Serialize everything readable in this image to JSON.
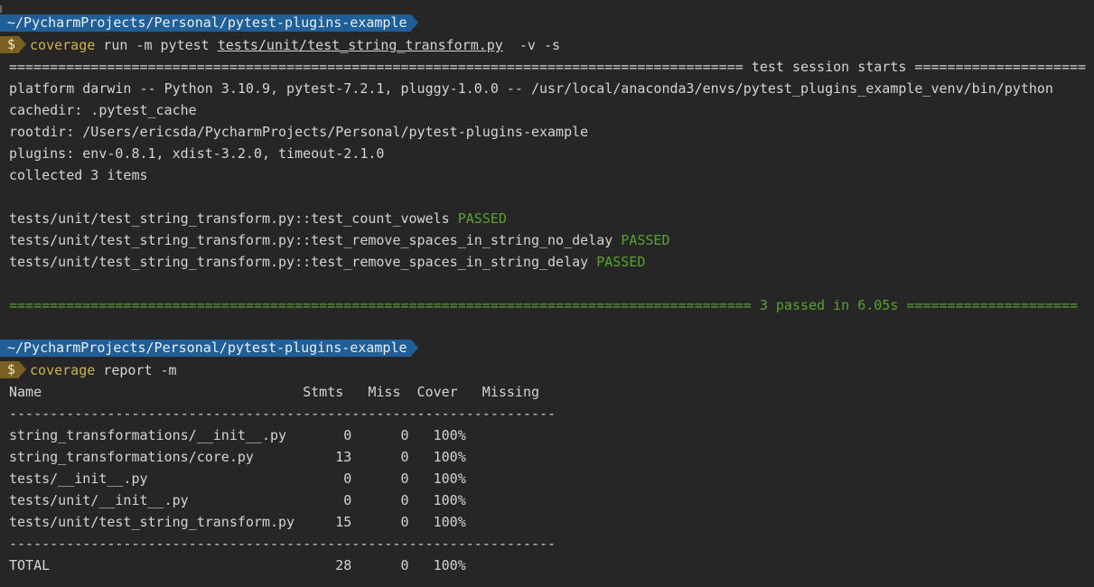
{
  "prompt1": {
    "path": "~/PycharmProjects/Personal/pytest-plugins-example",
    "symbol": "$",
    "command": "coverage",
    "args_prefix": " run -m pytest ",
    "file_arg": "tests/unit/test_string_transform.py",
    "args_suffix": "  -v -s"
  },
  "session": {
    "header": "========================================================================================== test session starts =====================",
    "platform": "platform darwin -- Python 3.10.9, pytest-7.2.1, pluggy-1.0.0 -- /usr/local/anaconda3/envs/pytest_plugins_example_venv/bin/python",
    "cachedir": "cachedir: .pytest_cache",
    "rootdir": "rootdir: /Users/ericsda/PycharmProjects/Personal/pytest-plugins-example",
    "plugins": "plugins: env-0.8.1, xdist-3.2.0, timeout-2.1.0",
    "collected": "collected 3 items"
  },
  "tests": [
    {
      "name": "tests/unit/test_string_transform.py::test_count_vowels",
      "status": "PASSED"
    },
    {
      "name": "tests/unit/test_string_transform.py::test_remove_spaces_in_string_no_delay",
      "status": "PASSED"
    },
    {
      "name": "tests/unit/test_string_transform.py::test_remove_spaces_in_string_delay",
      "status": "PASSED"
    }
  ],
  "summary": "=========================================================================================== 3 passed in 6.05s =====================",
  "prompt2": {
    "path": "~/PycharmProjects/Personal/pytest-plugins-example",
    "symbol": "$",
    "command": "coverage",
    "args": " report -m"
  },
  "report": {
    "header": "Name                                Stmts   Miss  Cover   Missing",
    "separator": "-------------------------------------------------------------------",
    "rows": [
      "string_transformations/__init__.py       0      0   100%",
      "string_transformations/core.py          13      0   100%",
      "tests/__init__.py                        0      0   100%",
      "tests/unit/__init__.py                   0      0   100%",
      "tests/unit/test_string_transform.py     15      0   100%"
    ],
    "separator2": "-------------------------------------------------------------------",
    "total": "TOTAL                                   28      0   100%"
  },
  "colors": {
    "background": "#262626",
    "path_chip": "#1f5e96",
    "prompt_chip": "#7a5f23",
    "command": "#d1b24a",
    "passed": "#58a32f"
  }
}
